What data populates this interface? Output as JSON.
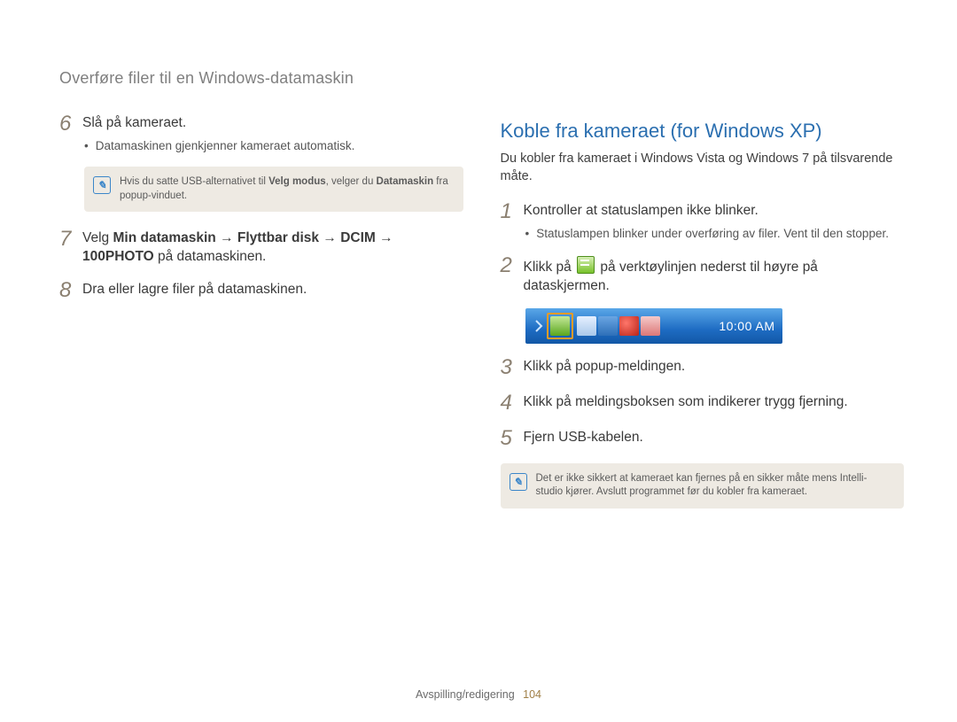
{
  "header": "Overføre filer til en Windows-datamaskin",
  "left": {
    "steps": [
      {
        "num": "6",
        "text": "Slå på kameraet.",
        "bullet": "Datamaskinen gjenkjenner kameraet automatisk."
      },
      {
        "num": "7",
        "prefix": "Velg ",
        "bold1": "Min datamaskin",
        "arrow1": " → ",
        "bold2": "Flyttbar disk",
        "arrow2": " → ",
        "bold3": "DCIM",
        "arrow3": " → ",
        "bold4": "100PHOTO",
        "suffix": " på datamaskinen."
      },
      {
        "num": "8",
        "text": "Dra eller lagre filer på datamaskinen."
      }
    ],
    "note": {
      "pre": "Hvis du satte USB-alternativet til ",
      "b1": "Velg modus",
      "mid": ", velger du ",
      "b2": "Datamaskin",
      "post": " fra popup-vinduet."
    }
  },
  "right": {
    "title": "Koble fra kameraet (for Windows XP)",
    "subtext": "Du kobler fra kameraet i Windows Vista og Windows 7 på tilsvarende måte.",
    "steps": [
      {
        "num": "1",
        "text": "Kontroller at statuslampen ikke blinker.",
        "bullet": "Statuslampen blinker under overføring av filer. Vent til den stopper."
      },
      {
        "num": "2",
        "pre": "Klikk på ",
        "post": " på verktøylinjen nederst til høyre på dataskjermen."
      },
      {
        "num": "3",
        "text": "Klikk på popup-meldingen."
      },
      {
        "num": "4",
        "text": "Klikk på meldingsboksen som indikerer trygg fjerning."
      },
      {
        "num": "5",
        "text": "Fjern USB-kabelen."
      }
    ],
    "note": "Det er ikke sikkert at kameraet kan fjernes på en sikker måte mens Intelli-studio kjører. Avslutt programmet før du kobler fra kameraet.",
    "systray_time": "10:00 AM"
  },
  "footer": {
    "section": "Avspilling/redigering",
    "page": "104"
  }
}
